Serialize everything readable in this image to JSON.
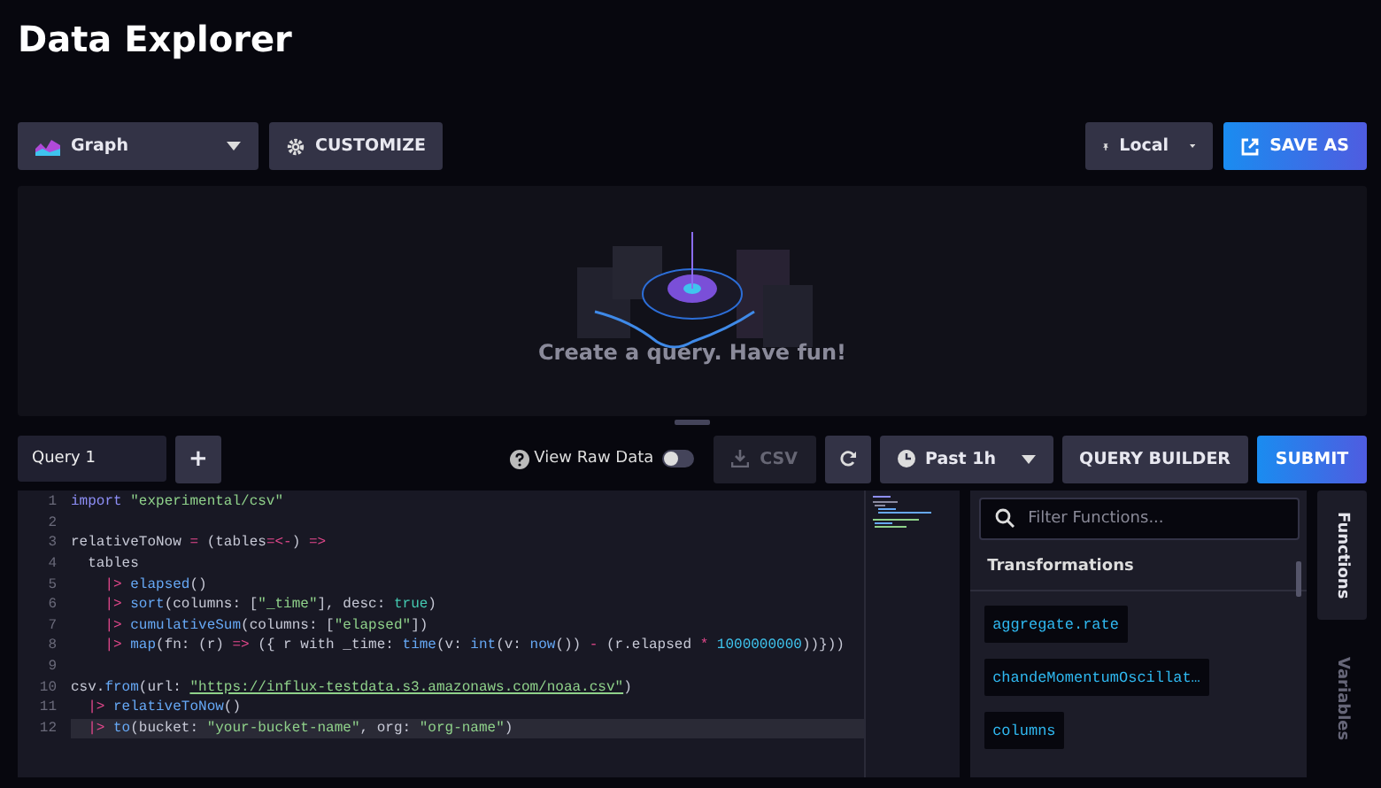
{
  "page_title": "Data Explorer",
  "toolbar": {
    "view_type": "Graph",
    "customize": "CUSTOMIZE",
    "timezone": "Local",
    "save_as": "SAVE AS"
  },
  "empty_state": {
    "message": "Create a query. Have fun!"
  },
  "query_bar": {
    "query_tabs": [
      {
        "label": "Query 1",
        "selected": true
      }
    ],
    "add": "+",
    "raw_data_label": "View Raw Data",
    "raw_data_on": false,
    "csv": "CSV",
    "csv_disabled": true,
    "time_range": "Past 1h",
    "query_builder": "QUERY BUILDER",
    "submit": "SUBMIT"
  },
  "editor": {
    "lines": [
      {
        "number": "1",
        "current": false,
        "tokens": [
          {
            "kind": "keyword",
            "text": "import"
          },
          {
            "kind": "string",
            "text": " \"experimental/csv\""
          }
        ]
      },
      {
        "number": "2",
        "current": false
      },
      {
        "number": "3",
        "current": false,
        "tokens": [
          {
            "kind": "plain",
            "text": "relativeToNow "
          },
          {
            "kind": "operator",
            "text": "="
          },
          {
            "kind": "plain",
            "text": " (tables"
          },
          {
            "kind": "operator",
            "text": "=<-"
          },
          {
            "kind": "plain",
            "text": ") "
          },
          {
            "kind": "operator",
            "text": "=>"
          }
        ]
      },
      {
        "number": "4",
        "current": false,
        "tokens": [
          {
            "kind": "plain",
            "text": "  tables"
          }
        ]
      },
      {
        "number": "5",
        "current": false,
        "tokens": [
          {
            "kind": "operator",
            "text": "    |>"
          },
          {
            "kind": "function",
            "text": " elapsed"
          },
          {
            "kind": "plain",
            "text": "()"
          }
        ]
      },
      {
        "number": "6",
        "current": false,
        "tokens": [
          {
            "kind": "operator",
            "text": "    |>"
          },
          {
            "kind": "function",
            "text": " sort"
          },
          {
            "kind": "plain",
            "text": "(columns: ["
          },
          {
            "kind": "string",
            "text": "\"_time\""
          },
          {
            "kind": "plain",
            "text": "], desc: "
          },
          {
            "kind": "bool",
            "text": "true"
          },
          {
            "kind": "plain",
            "text": ")"
          }
        ]
      },
      {
        "number": "7",
        "current": false,
        "tokens": [
          {
            "kind": "operator",
            "text": "    |>"
          },
          {
            "kind": "function",
            "text": " cumulativeSum"
          },
          {
            "kind": "plain",
            "text": "(columns: ["
          },
          {
            "kind": "string",
            "text": "\"elapsed\""
          },
          {
            "kind": "plain",
            "text": "])"
          }
        ]
      },
      {
        "number": "8",
        "current": false,
        "tokens": [
          {
            "kind": "operator",
            "text": "    |>"
          },
          {
            "kind": "function",
            "text": " map"
          },
          {
            "kind": "plain",
            "text": "(fn: (r) "
          },
          {
            "kind": "operator",
            "text": "=>"
          },
          {
            "kind": "plain",
            "text": " ({ r with _time: "
          },
          {
            "kind": "function",
            "text": "time"
          },
          {
            "kind": "plain",
            "text": "(v: "
          },
          {
            "kind": "function",
            "text": "int"
          },
          {
            "kind": "plain",
            "text": "(v: "
          },
          {
            "kind": "function",
            "text": "now"
          },
          {
            "kind": "plain",
            "text": "()) "
          },
          {
            "kind": "operator",
            "text": "-"
          },
          {
            "kind": "plain",
            "text": " (r.elapsed "
          },
          {
            "kind": "operator",
            "text": "*"
          },
          {
            "kind": "number",
            "text": " 1000000000"
          },
          {
            "kind": "plain",
            "text": "))}))"
          }
        ]
      },
      {
        "number": "9",
        "current": false
      },
      {
        "number": "10",
        "current": false,
        "tokens": [
          {
            "kind": "plain",
            "text": "csv."
          },
          {
            "kind": "function",
            "text": "from"
          },
          {
            "kind": "plain",
            "text": "(url: "
          },
          {
            "kind": "link",
            "text": "\"https://influx-testdata.s3.amazonaws.com/noaa.csv\""
          },
          {
            "kind": "plain",
            "text": ")"
          }
        ]
      },
      {
        "number": "11",
        "current": false,
        "tokens": [
          {
            "kind": "operator",
            "text": "  |>"
          },
          {
            "kind": "function",
            "text": " relativeToNow"
          },
          {
            "kind": "plain",
            "text": "()"
          }
        ]
      },
      {
        "number": "12",
        "current": true,
        "tokens": [
          {
            "kind": "operator",
            "text": "  |>"
          },
          {
            "kind": "function",
            "text": " to"
          },
          {
            "kind": "plain",
            "text": "(bucket: "
          },
          {
            "kind": "string",
            "text": "\"your-bucket-name\""
          },
          {
            "kind": "plain",
            "text": ", org: "
          },
          {
            "kind": "string",
            "text": "\"org-name\""
          },
          {
            "kind": "plain",
            "text": ")"
          }
        ]
      }
    ]
  },
  "functions_panel": {
    "filter_placeholder": "Filter Functions...",
    "section": "Transformations",
    "functions": [
      "aggregate.rate",
      "chandeMomentumOscillat…",
      "columns"
    ]
  },
  "side_tabs": [
    {
      "label": "Functions",
      "selected": true
    },
    {
      "label": "Variables",
      "selected": false
    }
  ]
}
